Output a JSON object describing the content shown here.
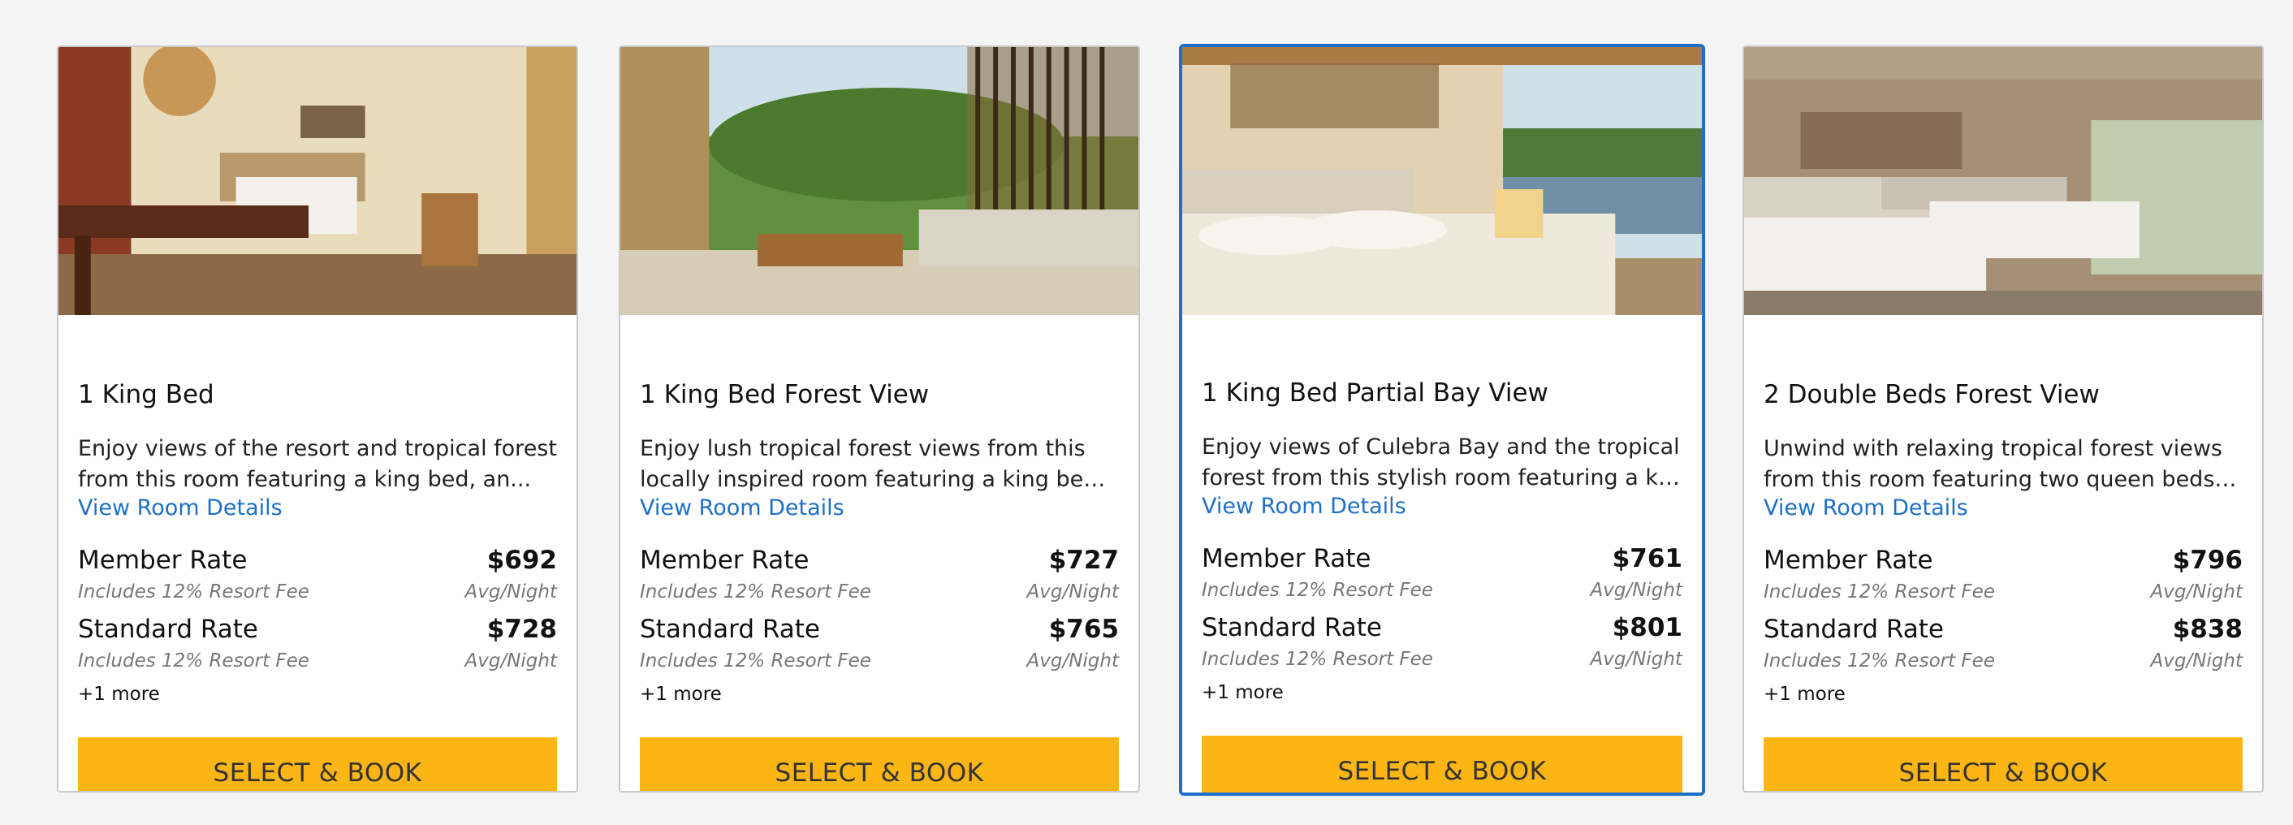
{
  "rooms": [
    {
      "title": "1 King Bed",
      "desc_line1": "Enjoy views of the resort and tropical forest",
      "desc_line2": "from this room featuring a king bed, an...",
      "details_link": "View Room Details",
      "member_rate_label": "Member Rate",
      "member_price": "$692",
      "standard_rate_label": "Standard Rate",
      "standard_price": "$728",
      "fee_note": "Includes 12% Resort Fee",
      "unit": "Avg/Night",
      "more": "+1 more",
      "button": "SELECT & BOOK",
      "selected": false
    },
    {
      "title": "1 King Bed Forest View",
      "desc_line1": "Enjoy lush tropical forest views from this",
      "desc_line2": "locally inspired room featuring a king bed, a...",
      "details_link": "View Room Details",
      "member_rate_label": "Member Rate",
      "member_price": "$727",
      "standard_rate_label": "Standard Rate",
      "standard_price": "$765",
      "fee_note": "Includes 12% Resort Fee",
      "unit": "Avg/Night",
      "more": "+1 more",
      "button": "SELECT & BOOK",
      "selected": false
    },
    {
      "title": "1 King Bed Partial Bay View",
      "desc_line1": "Enjoy views of Culebra Bay and the tropical",
      "desc_line2": "forest from this stylish room featuring a kin...",
      "details_link": "View Room Details",
      "member_rate_label": "Member Rate",
      "member_price": "$761",
      "standard_rate_label": "Standard Rate",
      "standard_price": "$801",
      "fee_note": "Includes 12% Resort Fee",
      "unit": "Avg/Night",
      "more": "+1 more",
      "button": "SELECT & BOOK",
      "selected": true
    },
    {
      "title": "2 Double Beds Forest View",
      "desc_line1": "Unwind with relaxing tropical forest views",
      "desc_line2": "from this room featuring two queen beds, a...",
      "details_link": "View Room Details",
      "member_rate_label": "Member Rate",
      "member_price": "$796",
      "standard_rate_label": "Standard Rate",
      "standard_price": "$838",
      "fee_note": "Includes 12% Resort Fee",
      "unit": "Avg/Night",
      "more": "+1 more",
      "button": "SELECT & BOOK",
      "selected": false
    }
  ],
  "colors": {
    "accent_button": "#fbb515",
    "link": "#1e6fc7",
    "selected_border": "#1e6fc7",
    "muted_text": "#777777"
  }
}
